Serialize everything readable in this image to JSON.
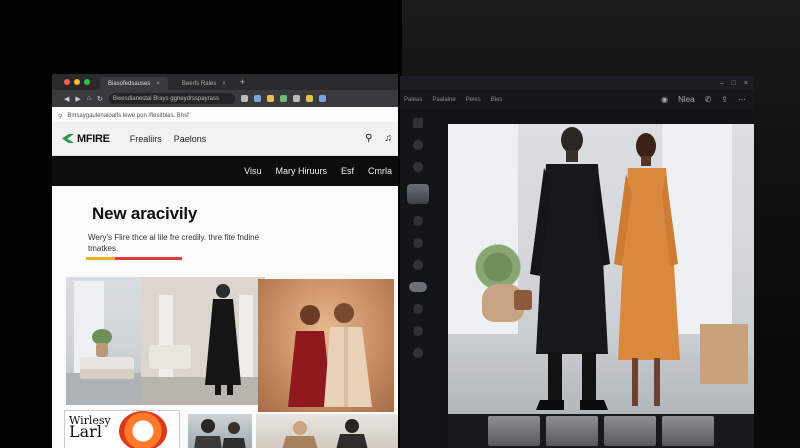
{
  "left_browser": {
    "tabs": [
      {
        "label": "Biasofedsauses",
        "active": true
      },
      {
        "label": "Beerfs Rales",
        "active": false
      }
    ],
    "omnibox_text": "Bwesdianestal Brays ggneydrsspayrass",
    "address_line_text": "Bmsaygaulenaloalfs.lewe pon /flesitblas. Bhsf",
    "site": {
      "logo": "MFIRE",
      "nav": [
        "Frealiirs",
        "Paelons"
      ],
      "menu": [
        "Visu",
        "Mary Hiruurs",
        "Esf",
        "Cmrla"
      ],
      "hero_title": "New aracivily",
      "hero_subtitle": "Wery's Flire thce al lile fre credily. thre fite fndine tmatkes.",
      "promo_lines": [
        "Wirlesy",
        "Larl"
      ]
    }
  },
  "right_app": {
    "topbar_labels": [
      "Paleas",
      "Paalaine",
      "Peies",
      "Bles"
    ],
    "tool_labels": [
      "Nlea"
    ]
  },
  "colors": {
    "accent_yellow": "#e7b324",
    "accent_red": "#e03a3a",
    "logo_green": "#2f9a4a"
  }
}
